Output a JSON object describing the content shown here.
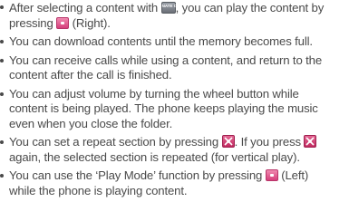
{
  "items": [
    {
      "line1_pre": "After selecting a content with ",
      "icon1_text": "NATE OK",
      "line1_post": ", you can play the content by",
      "line2_pre": "pressing ",
      "line2_post": " (Right)."
    },
    {
      "line1": "You can download contents until the memory becomes full."
    },
    {
      "line1": "You can receive calls while using a content, and return to the",
      "line2": "content after the call is finished."
    },
    {
      "line1": "You can adjust volume by turning the wheel button while",
      "line2": "content is being played. The phone keeps playing the music",
      "line3": "even when you close the folder."
    },
    {
      "line1_pre": "You can set a repeat section by pressing ",
      "line1_post": ". If you press ",
      "line2": "again, the selected section is repeated  (for vertical play)."
    },
    {
      "line1_pre": "You can use the ‘Play Mode’ function by pressing ",
      "line1_post": " (Left)",
      "line2": "while the phone is playing content."
    }
  ],
  "icons": {
    "nate_ok": "nate-ok-key",
    "right_key": "pink-navigation-key",
    "repeat_key": "repeat-section-key",
    "left_key": "pink-navigation-key"
  },
  "colors": {
    "text": "#4a4a4a",
    "key_pink": "#d63f7c",
    "key_gray": "#6c7078"
  }
}
